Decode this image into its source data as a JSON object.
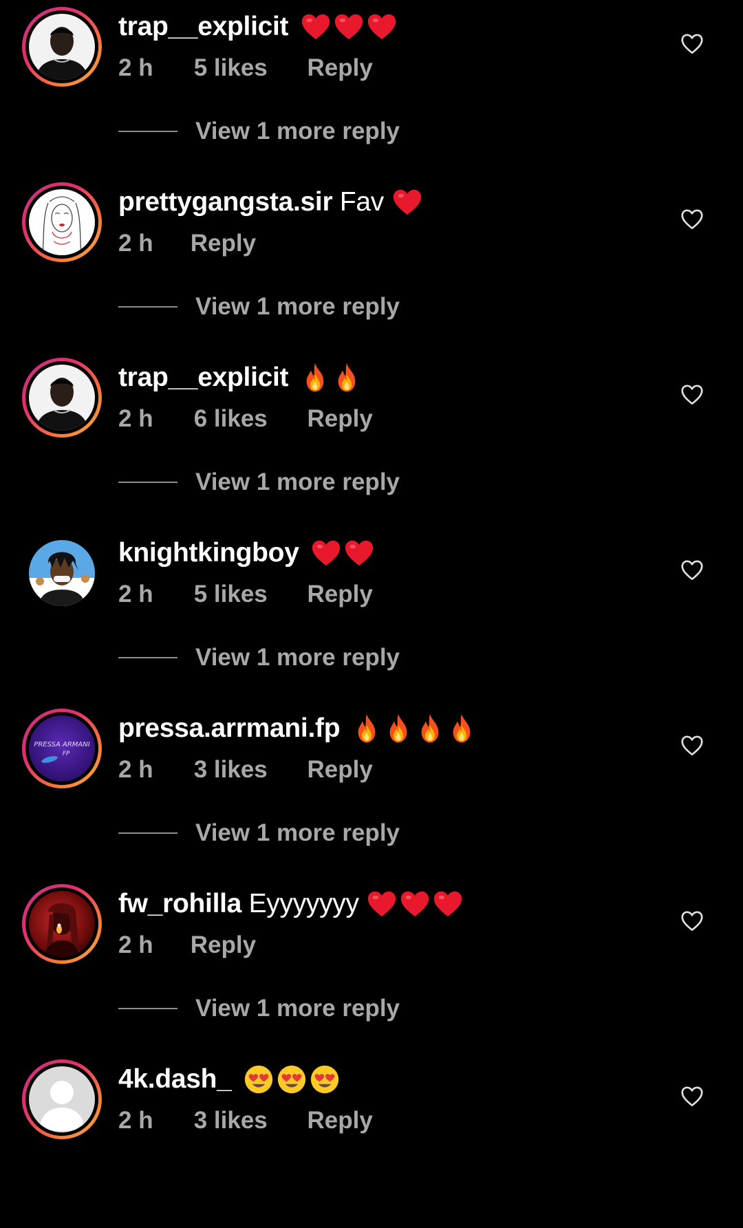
{
  "colors": {
    "background": "#000000",
    "primary_text": "#ffffff",
    "secondary_text": "#a8a8a8",
    "story_ring": [
      "#c13584",
      "#e1306c",
      "#f77737",
      "#fcaf45"
    ]
  },
  "comments": [
    {
      "username": "trap__explicit",
      "text": "",
      "emojis": [
        "red-heart",
        "red-heart",
        "red-heart"
      ],
      "time": "2 h",
      "likes": "5 likes",
      "reply": "Reply",
      "view_more": "View 1 more reply",
      "avatar": "portrait-dark",
      "story_ring": true
    },
    {
      "username": "prettygangsta.sir",
      "text": "Fav",
      "emojis": [
        "red-heart"
      ],
      "time": "2 h",
      "likes": "",
      "reply": "Reply",
      "view_more": "View 1 more reply",
      "avatar": "line-drawing",
      "story_ring": true
    },
    {
      "username": "trap__explicit",
      "text": "",
      "emojis": [
        "fire",
        "fire"
      ],
      "time": "2 h",
      "likes": "6 likes",
      "reply": "Reply",
      "view_more": "View 1 more reply",
      "avatar": "portrait-dark",
      "story_ring": true
    },
    {
      "username": "knightkingboy",
      "text": "",
      "emojis": [
        "red-heart",
        "red-heart"
      ],
      "time": "2 h",
      "likes": "5 likes",
      "reply": "Reply",
      "view_more": "View 1 more reply",
      "avatar": "cartoon",
      "story_ring": false
    },
    {
      "username": "pressa.arrmani.fp",
      "text": "",
      "emojis": [
        "fire",
        "fire",
        "fire",
        "fire"
      ],
      "time": "2 h",
      "likes": "3 likes",
      "reply": "Reply",
      "view_more": "View 1 more reply",
      "avatar": "purple-logo",
      "avatar_text": "PRESSA ARMANI FP",
      "story_ring": true
    },
    {
      "username": "fw_rohilla",
      "text": "Eyyyyyyy",
      "emojis": [
        "red-heart",
        "red-heart",
        "red-heart"
      ],
      "time": "2 h",
      "likes": "",
      "reply": "Reply",
      "view_more": "View 1 more reply",
      "avatar": "red-photo",
      "story_ring": true
    },
    {
      "username": "4k.dash_",
      "text": "",
      "emojis": [
        "heart-eyes",
        "heart-eyes",
        "heart-eyes"
      ],
      "time": "2 h",
      "likes": "3 likes",
      "reply": "Reply",
      "view_more": "",
      "avatar": "default-avatar",
      "story_ring": true
    }
  ]
}
